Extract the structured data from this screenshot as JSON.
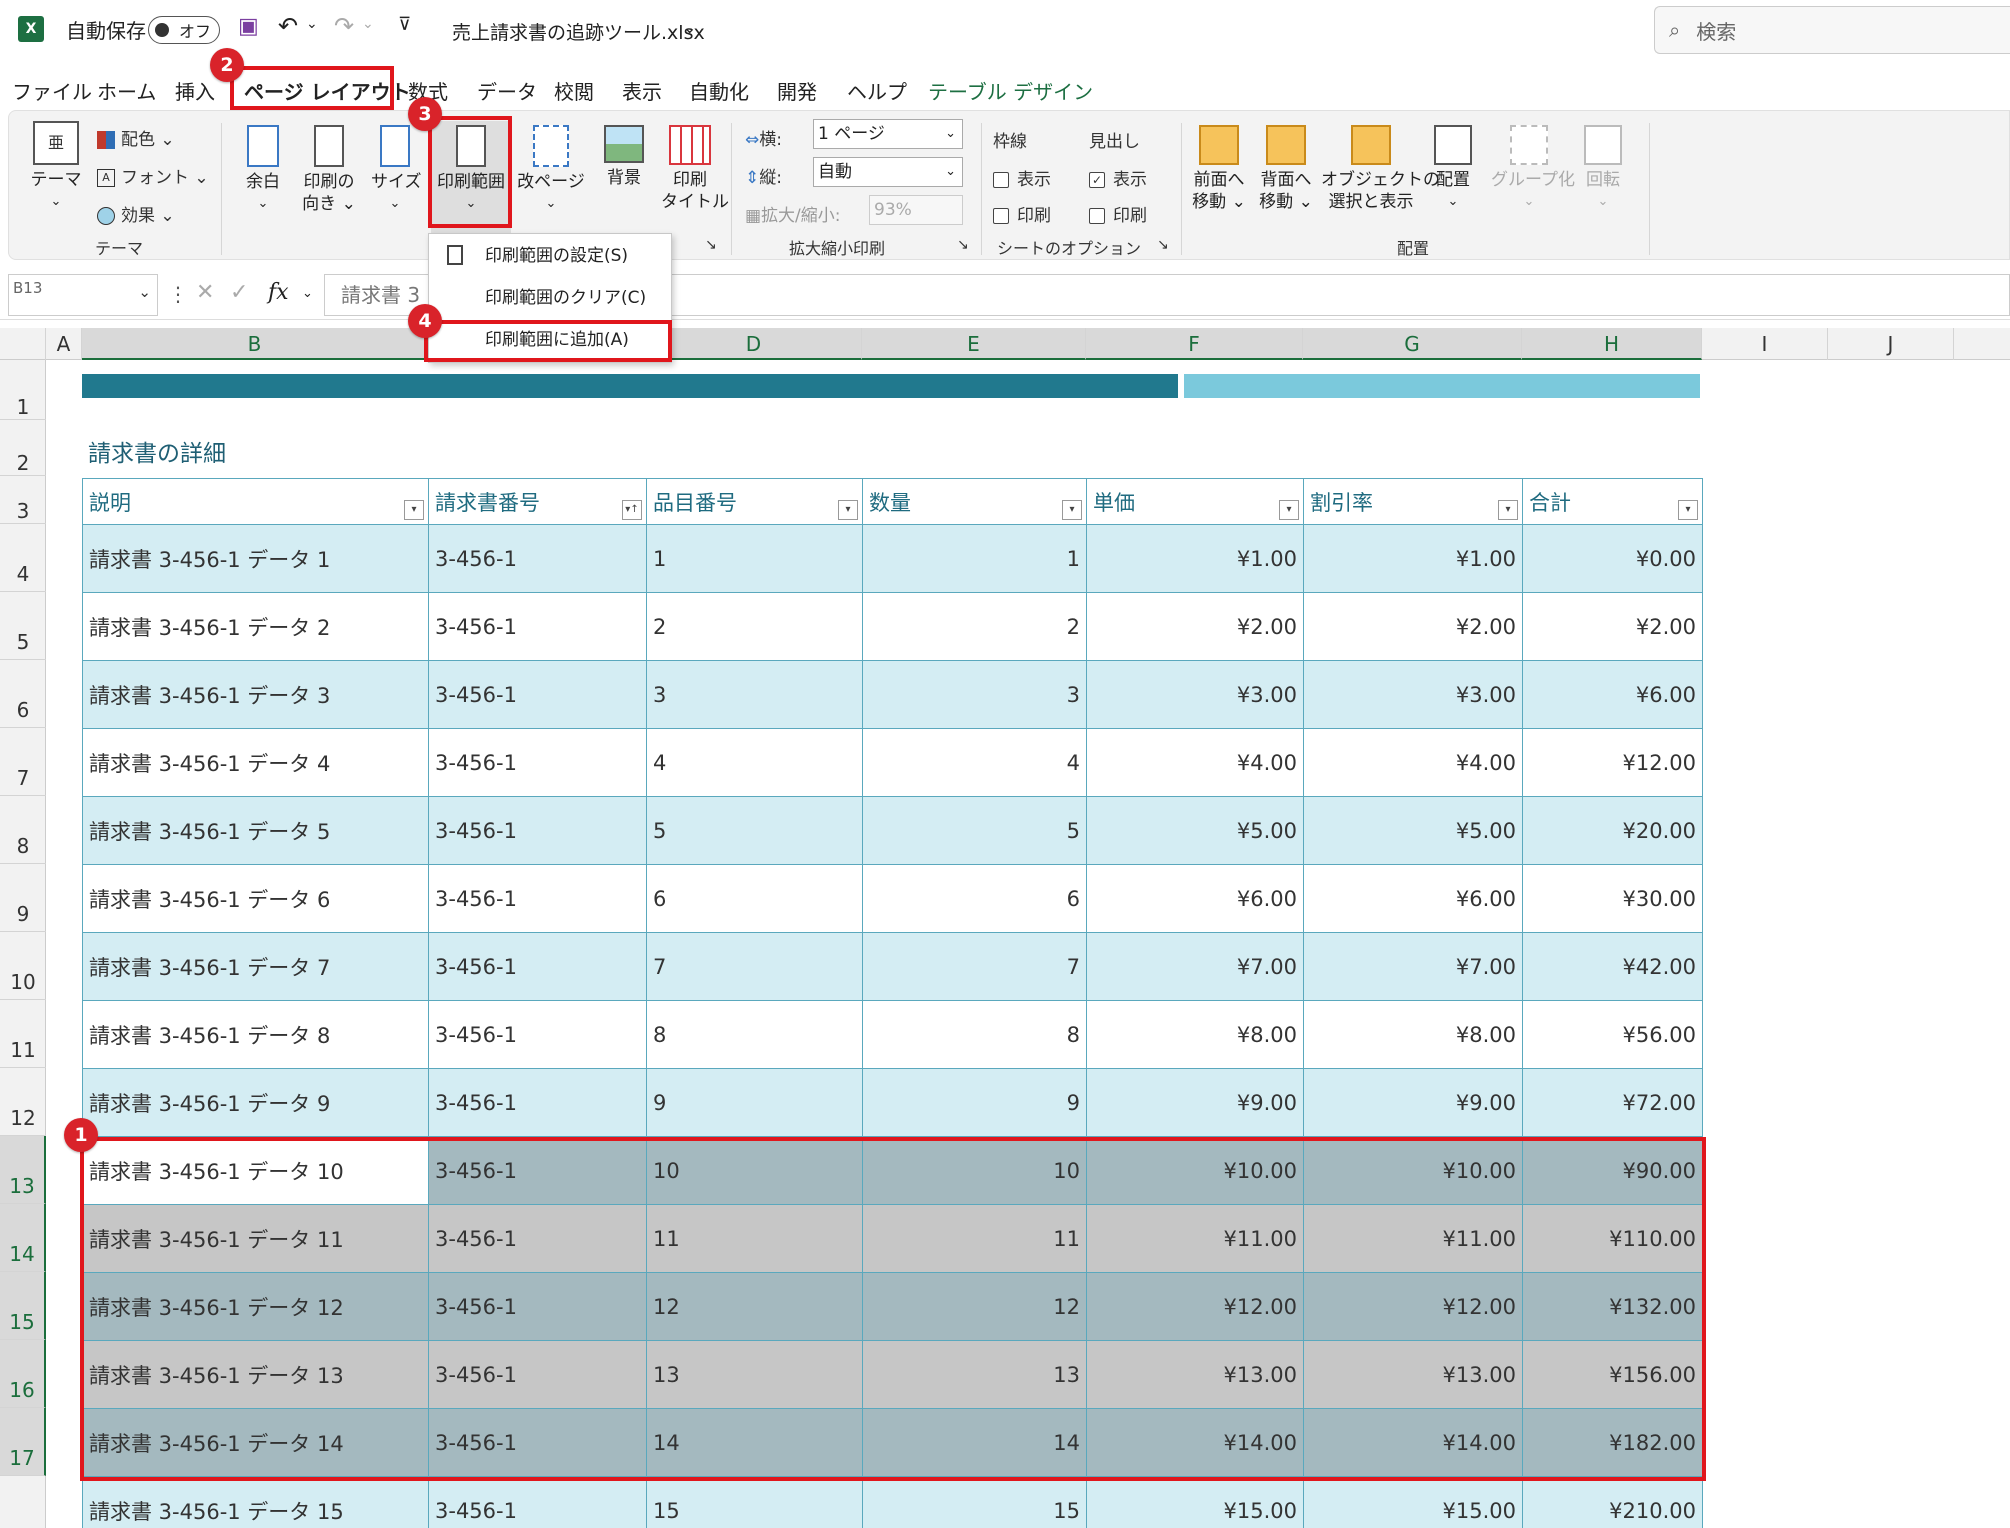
{
  "titlebar": {
    "autosave_label": "自動保存",
    "autosave_state": "オフ",
    "filename": "売上請求書の追跡ツール.xlsx",
    "search_placeholder": "検索"
  },
  "menu": {
    "tabs": [
      "ファイル",
      "ホーム",
      "挿入",
      "ページ レイアウト",
      "数式",
      "データ",
      "校閲",
      "表示",
      "自動化",
      "開発",
      "ヘルプ",
      "テーブル デザイン"
    ]
  },
  "ribbon": {
    "theme": {
      "theme_label": "テーマ",
      "colors_label": "配色",
      "fonts_label": "フォント",
      "effects_label": "効果",
      "group_label": "テーマ"
    },
    "page_setup": {
      "margin": "余白",
      "orientation_line1": "印刷の",
      "orientation_line2": "向き",
      "size": "サイズ",
      "print_area": "印刷範囲",
      "breaks": "改ページ",
      "background": "背景",
      "print_titles_line1": "印刷",
      "print_titles_line2": "タイトル"
    },
    "scale": {
      "width_label": "横:",
      "width_value": "1 ページ",
      "height_label": "縦:",
      "height_value": "自動",
      "scale_label": "拡大/縮小:",
      "scale_value": "93%",
      "group_label": "拡大縮小印刷"
    },
    "sheet_options": {
      "gridlines": "枠線",
      "headings": "見出し",
      "view": "表示",
      "print": "印刷",
      "group_label": "シートのオプション"
    },
    "arrange": {
      "bring_forward_line1": "前面へ",
      "bring_forward_line2": "移動",
      "send_backward_line1": "背面へ",
      "send_backward_line2": "移動",
      "selection_pane_line1": "オブジェクトの",
      "selection_pane_line2": "選択と表示",
      "align": "配置",
      "group": "グループ化",
      "rotate": "回転",
      "group_label": "配置"
    }
  },
  "dropdown": {
    "items": [
      "印刷範囲の設定(S)",
      "印刷範囲のクリア(C)",
      "印刷範囲に追加(A)"
    ]
  },
  "formula_bar": {
    "name_box": "B13",
    "fx": "fx",
    "content": "請求書 3"
  },
  "columns": [
    "A",
    "B",
    "C",
    "D",
    "E",
    "F",
    "G",
    "H",
    "I",
    "J"
  ],
  "rows": [
    "1",
    "2",
    "3",
    "4",
    "5",
    "6",
    "7",
    "8",
    "9",
    "10",
    "11",
    "12",
    "13",
    "14",
    "15",
    "16",
    "17"
  ],
  "sheet": {
    "title": "請求書の詳細",
    "headers": [
      "説明",
      "請求書番号",
      "品目番号",
      "数量",
      "単価",
      "割引率",
      "合計"
    ],
    "data": [
      [
        "請求書 3-456-1 データ 1",
        "3-456-1",
        "1",
        "1",
        "¥1.00",
        "¥1.00",
        "¥0.00"
      ],
      [
        "請求書 3-456-1 データ 2",
        "3-456-1",
        "2",
        "2",
        "¥2.00",
        "¥2.00",
        "¥2.00"
      ],
      [
        "請求書 3-456-1 データ 3",
        "3-456-1",
        "3",
        "3",
        "¥3.00",
        "¥3.00",
        "¥6.00"
      ],
      [
        "請求書 3-456-1 データ 4",
        "3-456-1",
        "4",
        "4",
        "¥4.00",
        "¥4.00",
        "¥12.00"
      ],
      [
        "請求書 3-456-1 データ 5",
        "3-456-1",
        "5",
        "5",
        "¥5.00",
        "¥5.00",
        "¥20.00"
      ],
      [
        "請求書 3-456-1 データ 6",
        "3-456-1",
        "6",
        "6",
        "¥6.00",
        "¥6.00",
        "¥30.00"
      ],
      [
        "請求書 3-456-1 データ 7",
        "3-456-1",
        "7",
        "7",
        "¥7.00",
        "¥7.00",
        "¥42.00"
      ],
      [
        "請求書 3-456-1 データ 8",
        "3-456-1",
        "8",
        "8",
        "¥8.00",
        "¥8.00",
        "¥56.00"
      ],
      [
        "請求書 3-456-1 データ 9",
        "3-456-1",
        "9",
        "9",
        "¥9.00",
        "¥9.00",
        "¥72.00"
      ],
      [
        "請求書 3-456-1 データ 10",
        "3-456-1",
        "10",
        "10",
        "¥10.00",
        "¥10.00",
        "¥90.00"
      ],
      [
        "請求書 3-456-1 データ 11",
        "3-456-1",
        "11",
        "11",
        "¥11.00",
        "¥11.00",
        "¥110.00"
      ],
      [
        "請求書 3-456-1 データ 12",
        "3-456-1",
        "12",
        "12",
        "¥12.00",
        "¥12.00",
        "¥132.00"
      ],
      [
        "請求書 3-456-1 データ 13",
        "3-456-1",
        "13",
        "13",
        "¥13.00",
        "¥13.00",
        "¥156.00"
      ],
      [
        "請求書 3-456-1 データ 14",
        "3-456-1",
        "14",
        "14",
        "¥14.00",
        "¥14.00",
        "¥182.00"
      ],
      [
        "請求書 3-456-1 データ 15",
        "3-456-1",
        "15",
        "15",
        "¥15.00",
        "¥15.00",
        "¥210.00"
      ]
    ]
  },
  "badges": [
    "1",
    "2",
    "3",
    "4"
  ],
  "colors": {
    "accent_red": "#e0161c",
    "badge_red": "#d9232a",
    "excel_green": "#1d6f42",
    "header_teal": "#21798e",
    "light_teal": "#7bc9dc",
    "band": "#d4edf3",
    "selection_gray": "#c6c6c6",
    "selection_dark": "#a4b9bf"
  }
}
